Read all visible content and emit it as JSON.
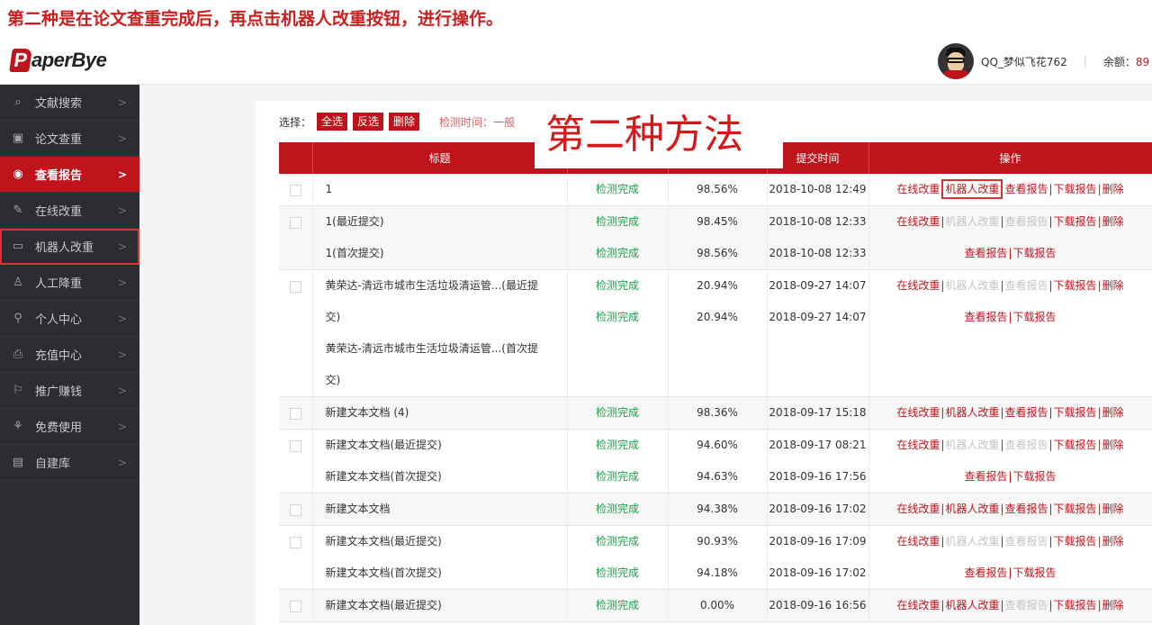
{
  "caption": "第二种是在论文查重完成后，再点击机器人改重按钮，进行操作。",
  "logo": {
    "letter": "P",
    "text": "aperBye"
  },
  "user": {
    "name": "QQ_梦似飞花762",
    "separator": "|",
    "balance_label": "余额：",
    "balance_value": "89"
  },
  "sidebar": {
    "items": [
      {
        "icon": "search-doc-icon",
        "glyph": "⌕",
        "label": "文献搜索",
        "chev": ">"
      },
      {
        "icon": "check-icon",
        "glyph": "▣",
        "label": "论文查重",
        "chev": ">"
      },
      {
        "icon": "eye-icon",
        "glyph": "◉",
        "label": "查看报告",
        "chev": ">"
      },
      {
        "icon": "edit-icon",
        "glyph": "✎",
        "label": "在线改重",
        "chev": ">"
      },
      {
        "icon": "robot-icon",
        "glyph": "▭",
        "label": "机器人改重",
        "chev": ">"
      },
      {
        "icon": "person-down-icon",
        "glyph": "♙",
        "label": "人工降重",
        "chev": ">"
      },
      {
        "icon": "user-icon",
        "glyph": "⚲",
        "label": "个人中心",
        "chev": ">"
      },
      {
        "icon": "wallet-icon",
        "glyph": "⎙",
        "label": "充值中心",
        "chev": ">"
      },
      {
        "icon": "flag-icon",
        "glyph": "⚐",
        "label": "推广赚钱",
        "chev": ">"
      },
      {
        "icon": "gift-icon",
        "glyph": "⚘",
        "label": "免费使用",
        "chev": ">"
      },
      {
        "icon": "library-icon",
        "glyph": "▤",
        "label": "自建库",
        "chev": ">"
      }
    ]
  },
  "select_bar": {
    "label": "选择：",
    "select_all": "全选",
    "invert": "反选",
    "delete": "删除",
    "check_time": "检测时间：一般"
  },
  "overlay_title": "第二种方法",
  "table": {
    "headers": [
      "",
      "标题",
      "",
      "",
      "提交时间",
      "操作"
    ],
    "ops": {
      "online": "在线改重",
      "robot": "机器人改重",
      "view": "查看报告",
      "download": "下载报告",
      "delete": "删除",
      "sep": "|"
    },
    "rows": [
      {
        "lines": [
          {
            "title": "1",
            "status": "检测完成",
            "rate": "98.56%",
            "time": "2018-10-08 12:49"
          }
        ]
      },
      {
        "lines": [
          {
            "title": "1(最近提交)",
            "status": "检测完成",
            "rate": "98.45%",
            "time": "2018-10-08 12:33"
          },
          {
            "title": "1(首次提交)",
            "status": "检测完成",
            "rate": "98.56%",
            "time": "2018-10-08 12:33"
          }
        ]
      },
      {
        "lines": [
          {
            "title": "黄荣达-清远市城市生活垃圾清运管...(最近提",
            "status": "检测完成",
            "rate": "20.94%",
            "time": "2018-09-27 14:07"
          },
          {
            "title": "交)",
            "status": "检测完成",
            "rate": "20.94%",
            "time": "2018-09-27 14:07"
          },
          {
            "title": "黄荣达-清远市城市生活垃圾清运管...(首次提",
            "status": "",
            "rate": "",
            "time": ""
          },
          {
            "title": "交)",
            "status": "",
            "rate": "",
            "time": ""
          }
        ]
      },
      {
        "lines": [
          {
            "title": "新建文本文档 (4)",
            "status": "检测完成",
            "rate": "98.36%",
            "time": "2018-09-17 15:18"
          }
        ]
      },
      {
        "lines": [
          {
            "title": "新建文本文档(最近提交)",
            "status": "检测完成",
            "rate": "94.60%",
            "time": "2018-09-17 08:21"
          },
          {
            "title": "新建文本文档(首次提交)",
            "status": "检测完成",
            "rate": "94.63%",
            "time": "2018-09-16 17:56"
          }
        ]
      },
      {
        "lines": [
          {
            "title": "新建文本文档",
            "status": "检测完成",
            "rate": "94.38%",
            "time": "2018-09-16 17:02"
          }
        ]
      },
      {
        "lines": [
          {
            "title": "新建文本文档(最近提交)",
            "status": "检测完成",
            "rate": "90.93%",
            "time": "2018-09-16 17:09"
          },
          {
            "title": "新建文本文档(首次提交)",
            "status": "检测完成",
            "rate": "94.18%",
            "time": "2018-09-16 17:02"
          }
        ]
      },
      {
        "lines": [
          {
            "title": "新建文本文档(最近提交)",
            "status": "检测完成",
            "rate": "0.00%",
            "time": "2018-09-16 16:56"
          }
        ]
      }
    ]
  }
}
